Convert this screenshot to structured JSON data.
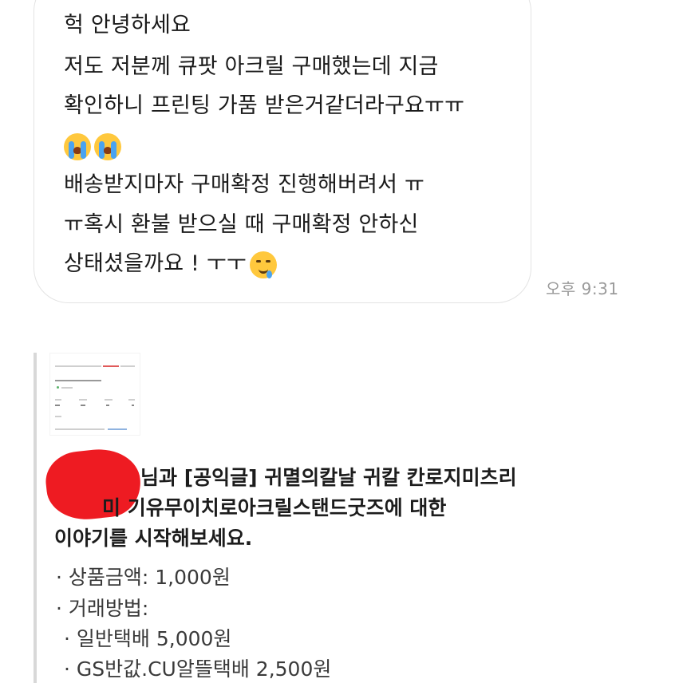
{
  "message": {
    "lines": [
      "헉 안녕하세요",
      "저도 저분께 큐팟 아크릴 구매했는데 지금",
      "확인하니 프린팅 가품 받은거같더라구요ㅠㅠ",
      "배송받지마자 구매확정 진행해버려서 ㅠ",
      "ㅠ혹시 환불 받으실 때 구매확정 안하신",
      "상태셨을까요 ! ㅜㅜ"
    ],
    "emoji_line": [
      "crying-face-icon",
      "crying-face-icon"
    ],
    "trailing_emoji": "face-holding-back-tears-icon",
    "time": "오후 9:31"
  },
  "product_card": {
    "title_lines": [
      "님과 [공익글] 귀멸의칼날 귀칼 칸로지미츠리",
      "미 기유무이치로아크릴스탠드굿즈에 대한",
      "이야기를 시작해보세요."
    ],
    "details": [
      "· 상품금액: 1,000원",
      "· 거래방법:",
      "· 일반택배 5,000원",
      "· GS반값.CU알뜰택배 2,500원"
    ],
    "redaction_color": "#ee1b22"
  },
  "colors": {
    "bubble_border": "#e3e3e3",
    "time_text": "#9a9a9a",
    "quote_bar": "#d8d8d8"
  }
}
